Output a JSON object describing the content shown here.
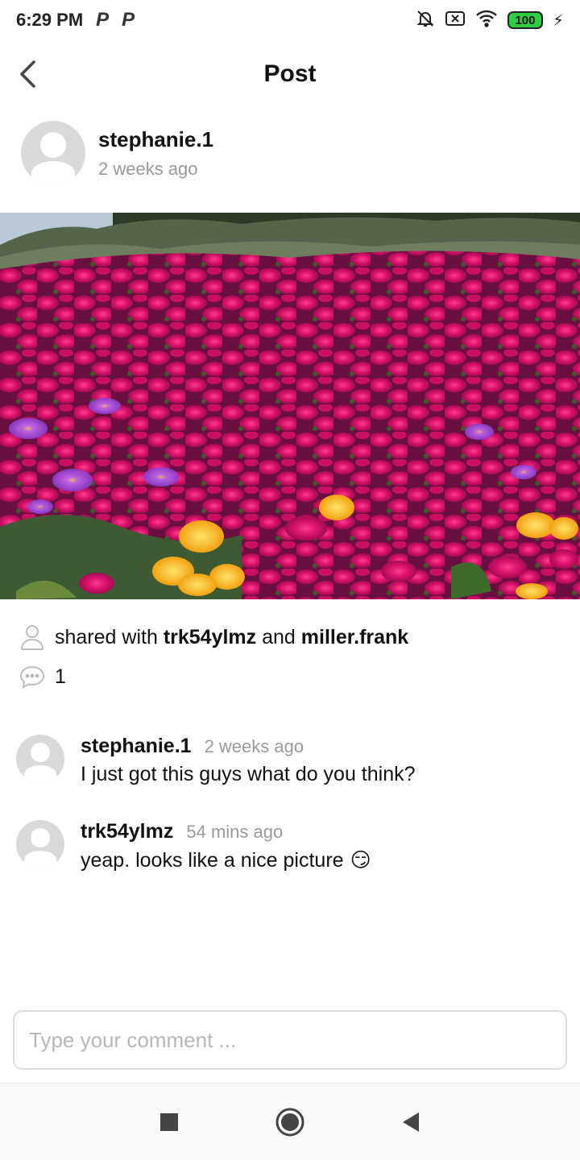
{
  "status_bar": {
    "time": "6:29 PM",
    "notification_icons": [
      "P",
      "P"
    ],
    "battery": "100"
  },
  "header": {
    "title": "Post"
  },
  "author": {
    "name": "stephanie.1",
    "time": "2 weeks ago"
  },
  "photo": {
    "icon": "flowers-photo"
  },
  "shared": {
    "prefix": "shared with",
    "user1": "trk54ylmz",
    "conjunction": "and",
    "user2": "miller.frank"
  },
  "comment_count": "1",
  "comments": [
    {
      "user": "stephanie.1",
      "time": "2 weeks ago",
      "text": "I just got this guys what do you think?"
    },
    {
      "user": "trk54ylmz",
      "time": "54 mins ago",
      "text": "yeap. looks like a nice picture",
      "emoji": "😏"
    }
  ],
  "input": {
    "placeholder": "Type your comment ..."
  },
  "colors": {
    "accent_battery": "#2ecc40",
    "muted_text": "#9a9a9a",
    "avatar_bg": "#d9d9d9"
  }
}
